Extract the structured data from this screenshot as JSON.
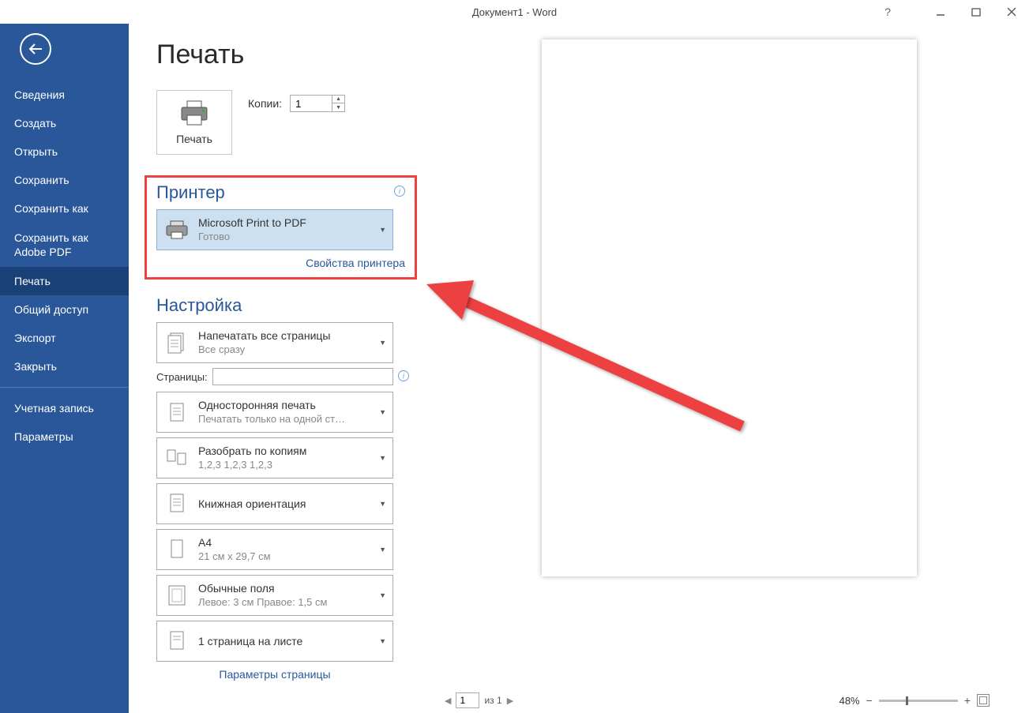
{
  "titlebar": {
    "title": "Документ1 - Word"
  },
  "sidebar": {
    "items": [
      {
        "label": "Сведения"
      },
      {
        "label": "Создать"
      },
      {
        "label": "Открыть"
      },
      {
        "label": "Сохранить"
      },
      {
        "label": "Сохранить как"
      },
      {
        "label": "Сохранить как Adobe PDF"
      },
      {
        "label": "Печать"
      },
      {
        "label": "Общий доступ"
      },
      {
        "label": "Экспорт"
      },
      {
        "label": "Закрыть"
      },
      {
        "label": "Учетная запись"
      },
      {
        "label": "Параметры"
      }
    ]
  },
  "print": {
    "page_title": "Печать",
    "print_button": "Печать",
    "copies_label": "Копии:",
    "copies_value": "1"
  },
  "printer": {
    "section": "Принтер",
    "name": "Microsoft Print to PDF",
    "status": "Готово",
    "properties_link": "Свойства принтера"
  },
  "settings": {
    "section": "Настройка",
    "print_all": {
      "main": "Напечатать все страницы",
      "sub": "Все сразу"
    },
    "pages_label": "Страницы:",
    "pages_value": "",
    "one_sided": {
      "main": "Односторонняя печать",
      "sub": "Печатать только на одной ст…"
    },
    "collated": {
      "main": "Разобрать по копиям",
      "sub": "1,2,3    1,2,3    1,2,3"
    },
    "orientation": {
      "main": "Книжная ориентация",
      "sub": ""
    },
    "paper": {
      "main": "A4",
      "sub": "21 см x 29,7 см"
    },
    "margins": {
      "main": "Обычные поля",
      "sub": "Левое:  3 см   Правое:  1,5 см"
    },
    "per_sheet": {
      "main": "1 страница на листе",
      "sub": ""
    },
    "page_setup_link": "Параметры страницы"
  },
  "footer": {
    "page_value": "1",
    "of_text": "из 1",
    "zoom_pct": "48%"
  }
}
